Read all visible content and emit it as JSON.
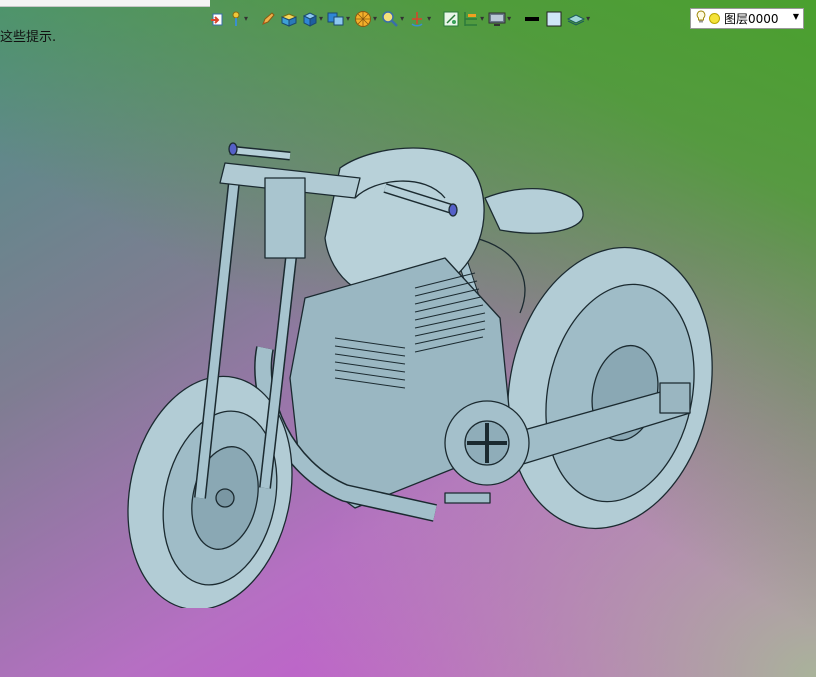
{
  "hint_text": "这些提示.",
  "toolbar": {
    "icons": [
      {
        "name": "exit-sketch-icon",
        "color": "#d9442b"
      },
      {
        "name": "pin-icon",
        "color": "#3a8fd0"
      },
      {
        "name": "pencil-icon",
        "color": "#e08a2c"
      },
      {
        "name": "solid-box-icon",
        "color": "#e8c83a"
      },
      {
        "name": "cube-view-icon",
        "color": "#2f86d6"
      },
      {
        "name": "views-icon",
        "color": "#2f86d6"
      },
      {
        "name": "render-style-icon",
        "color": "#f0a020"
      },
      {
        "name": "zoom-icon",
        "color": "#3a8fd0"
      },
      {
        "name": "rotate-axis-icon",
        "color": "#d9442b"
      },
      {
        "name": "section-view-icon",
        "color": "#3aa05a"
      },
      {
        "name": "grid-icon",
        "color": "#3aa05a"
      },
      {
        "name": "display-icon",
        "color": "#555555"
      },
      {
        "name": "line-color-icon",
        "color": "#000000"
      },
      {
        "name": "fill-color-icon",
        "color": "#cfe6f7"
      },
      {
        "name": "layers-icon",
        "color": "#3a9f9f"
      }
    ]
  },
  "layer": {
    "name": "图层0000"
  },
  "colors": {
    "model_fill": "#a7c4cf",
    "model_stroke": "#1b2a30",
    "bg_top_right": "#4aa02e",
    "bg_bottom_left": "#d14ad8"
  }
}
